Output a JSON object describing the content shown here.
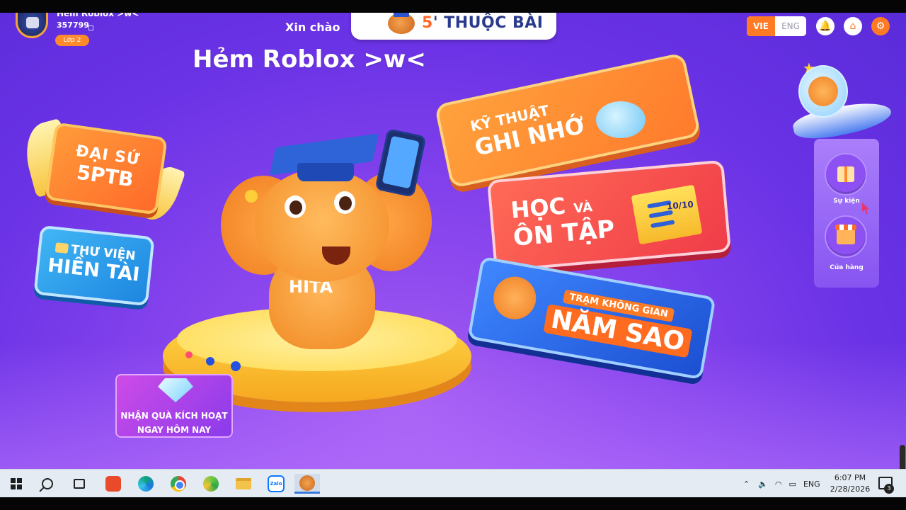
{
  "header": {
    "username": "Hẻm Roblox >w<",
    "coins": "357799",
    "grade": "Lớp 2",
    "greeting": "Xin chào",
    "logo_number": "5",
    "logo_text": "THUỘC BÀI",
    "room_title": "Hẻm Roblox >w<",
    "lang_vie": "VIE",
    "lang_eng": "ENG"
  },
  "left_banners": {
    "ambassador_line1": "ĐẠI SỨ",
    "ambassador_line2": "5PTB",
    "library_line1": "THƯ VIỆN",
    "library_line2": "HIỀN TÀI"
  },
  "mascot": {
    "shirt_text": "HITA"
  },
  "right_banners": {
    "memory_line1": "KỸ THUẬT",
    "memory_line2": "GHI NHỚ",
    "study_line1": "HỌC",
    "study_and": "VÀ",
    "study_line2": "ÔN TẬP",
    "score_badge": "10/10",
    "space_tag": "TRẠM KHÔNG GIAN",
    "space_big": "NĂM SAO"
  },
  "promo": {
    "line1": "NHẬN QUÀ KÍCH HOẠT",
    "line2": "NGAY HÔM NAY"
  },
  "side_menu": {
    "events_label": "Sự kiện",
    "shop_label": "Cửa hàng"
  },
  "taskbar": {
    "zalo_label": "Zalo",
    "tray_lang": "ENG",
    "time": "6:07 PM",
    "date": "2/28/2026",
    "notification_count": "3"
  },
  "colors": {
    "accent_orange": "#ff7a24",
    "bg_purple": "#6b33e6"
  }
}
